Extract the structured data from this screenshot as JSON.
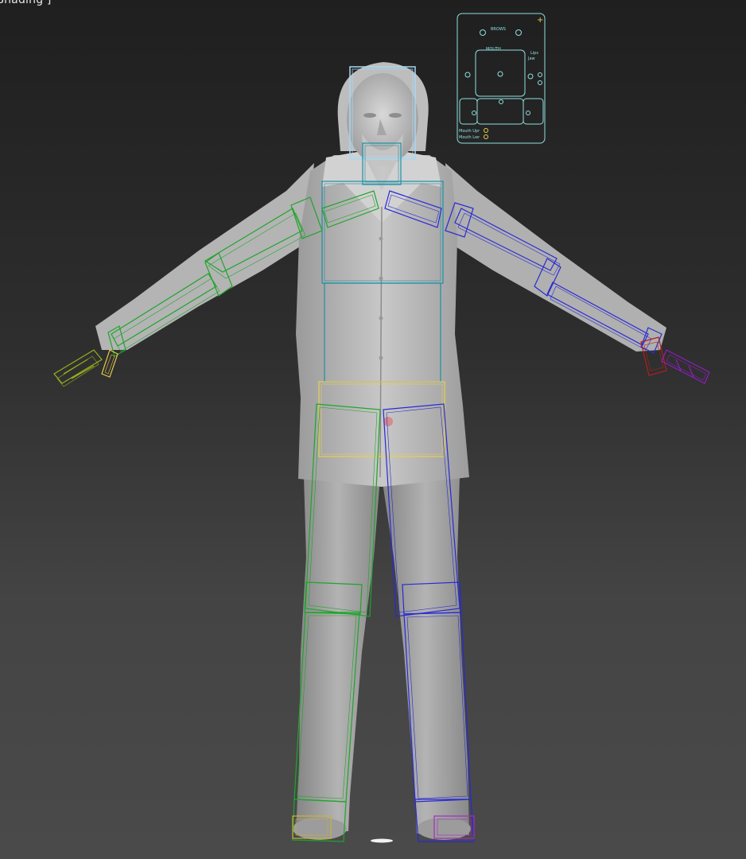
{
  "viewport": {
    "label": "Shading ]",
    "background_top": "#1f1f1f",
    "background_bottom": "#4a4a4a"
  },
  "facial_panel": {
    "title": "BROWS",
    "subtitle": "MOUTH",
    "corner_label_top": "Lips",
    "corner_label_bottom": "Jaw",
    "bottom_label_1": "Mouth Upr",
    "bottom_label_2": "Mouth Lwr",
    "color": "#8fe0e0"
  },
  "rig": {
    "head_color": "#a9d8f0",
    "spine_color": "#1f8fa6",
    "left_side_color": "#1ea52b",
    "right_side_color": "#2a2ad4",
    "pelvis_color": "#e3cf55",
    "left_hand_color": "#9ab01e",
    "right_hand_color": "#b01e1e",
    "right_fingers_color": "#8e1ec0",
    "left_foot_color": "#c9b23a",
    "right_foot_color": "#a52cc0"
  }
}
